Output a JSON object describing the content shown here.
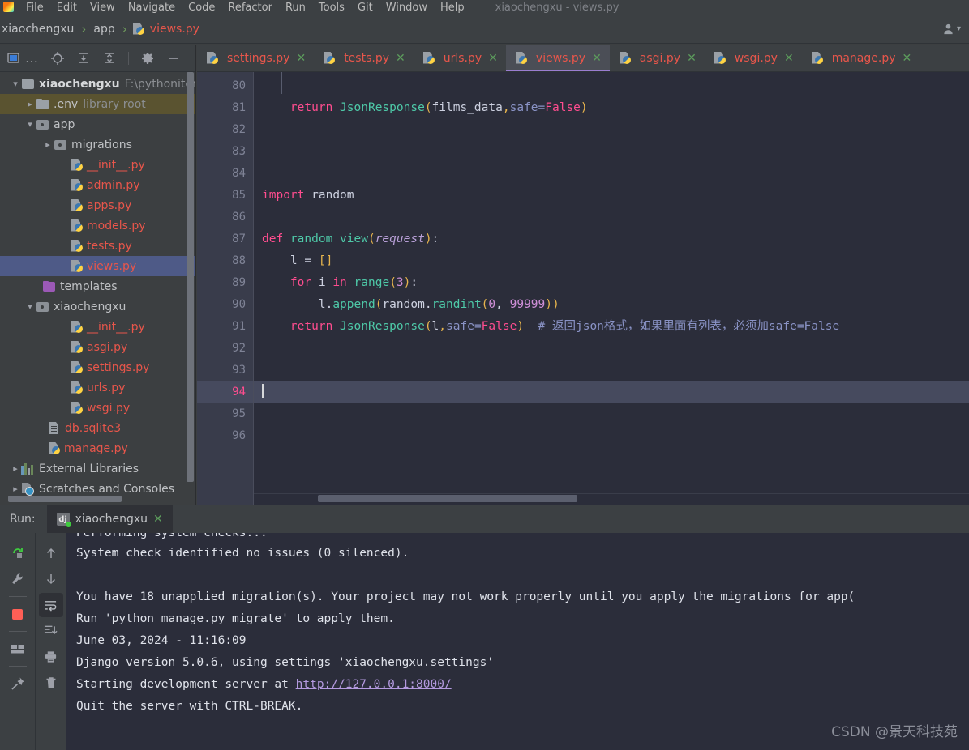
{
  "window": {
    "title": "xiaochengxu - views.py"
  },
  "menubar": {
    "logo": "pycharm-logo",
    "items": [
      {
        "label": "File"
      },
      {
        "label": "Edit"
      },
      {
        "label": "View"
      },
      {
        "label": "Navigate"
      },
      {
        "label": "Code"
      },
      {
        "label": "Refactor"
      },
      {
        "label": "Run"
      },
      {
        "label": "Tools"
      },
      {
        "label": "Git"
      },
      {
        "label": "Window"
      },
      {
        "label": "Help"
      }
    ]
  },
  "breadcrumb": {
    "items": [
      {
        "label": "xiaochengxu",
        "type": "project"
      },
      {
        "label": "app",
        "type": "folder"
      },
      {
        "label": "views.py",
        "type": "file"
      }
    ],
    "separator": "›"
  },
  "navbar": {
    "account_icon": "user-icon",
    "account_caret": "▾"
  },
  "project_panel": {
    "toolbar": [
      {
        "icon": "select-opened-file-icon",
        "glyph": "▣"
      },
      {
        "icon": "more-options-icon",
        "glyph": "…"
      },
      {
        "icon": "locate-icon",
        "glyph": "⊕"
      },
      {
        "icon": "expand-all-icon",
        "glyph": "↧"
      },
      {
        "icon": "collapse-all-icon",
        "glyph": "↥"
      },
      {
        "icon": "settings-gear-icon",
        "glyph": "⚙"
      },
      {
        "icon": "hide-panel-icon",
        "glyph": "—"
      }
    ],
    "tree": [
      {
        "label": "xiaochengxu",
        "secondary": "F:\\pythoniter",
        "type": "root-folder",
        "indent": 0,
        "arrow": "expanded",
        "bold": true,
        "selected": "none"
      },
      {
        "label": ".env",
        "secondary": "library root",
        "type": "folder",
        "indent": 1,
        "arrow": "collapsed",
        "bold": false,
        "selected": "olive"
      },
      {
        "label": "app",
        "secondary": "",
        "type": "module-folder",
        "indent": 1,
        "arrow": "expanded",
        "bold": false,
        "selected": "none"
      },
      {
        "label": "migrations",
        "secondary": "",
        "type": "module-folder",
        "indent": 2,
        "arrow": "collapsed",
        "bold": false,
        "selected": "none"
      },
      {
        "label": "__init__.py",
        "secondary": "",
        "type": "python-file",
        "indent": 3,
        "arrow": "none",
        "bold": false,
        "selected": "none"
      },
      {
        "label": "admin.py",
        "secondary": "",
        "type": "python-file",
        "indent": 3,
        "arrow": "none",
        "bold": false,
        "selected": "none"
      },
      {
        "label": "apps.py",
        "secondary": "",
        "type": "python-file",
        "indent": 3,
        "arrow": "none",
        "bold": false,
        "selected": "none"
      },
      {
        "label": "models.py",
        "secondary": "",
        "type": "python-file",
        "indent": 3,
        "arrow": "none",
        "bold": false,
        "selected": "none"
      },
      {
        "label": "tests.py",
        "secondary": "",
        "type": "python-file",
        "indent": 3,
        "arrow": "none",
        "bold": false,
        "selected": "none"
      },
      {
        "label": "views.py",
        "secondary": "",
        "type": "python-file",
        "indent": 3,
        "arrow": "none",
        "bold": false,
        "selected": "blue"
      },
      {
        "label": "templates",
        "secondary": "",
        "type": "templates-folder",
        "indent": 2,
        "arrow": "none",
        "bold": false,
        "selected": "none"
      },
      {
        "label": "xiaochengxu",
        "secondary": "",
        "type": "module-folder",
        "indent": 1,
        "arrow": "expanded",
        "bold": false,
        "selected": "none"
      },
      {
        "label": "__init__.py",
        "secondary": "",
        "type": "python-file",
        "indent": 3,
        "arrow": "none",
        "bold": false,
        "selected": "none"
      },
      {
        "label": "asgi.py",
        "secondary": "",
        "type": "python-file",
        "indent": 3,
        "arrow": "none",
        "bold": false,
        "selected": "none"
      },
      {
        "label": "settings.py",
        "secondary": "",
        "type": "python-file",
        "indent": 3,
        "arrow": "none",
        "bold": false,
        "selected": "none"
      },
      {
        "label": "urls.py",
        "secondary": "",
        "type": "python-file",
        "indent": 3,
        "arrow": "none",
        "bold": false,
        "selected": "none"
      },
      {
        "label": "wsgi.py",
        "secondary": "",
        "type": "python-file",
        "indent": 3,
        "arrow": "none",
        "bold": false,
        "selected": "none"
      },
      {
        "label": "db.sqlite3",
        "secondary": "",
        "type": "db-file",
        "indent": 2,
        "arrow": "none",
        "bold": false,
        "selected": "none"
      },
      {
        "label": "manage.py",
        "secondary": "",
        "type": "python-file",
        "indent": 2,
        "arrow": "none",
        "bold": false,
        "selected": "none"
      },
      {
        "label": "External Libraries",
        "secondary": "",
        "type": "libraries",
        "indent": 0,
        "arrow": "collapsed",
        "bold": false,
        "selected": "none"
      },
      {
        "label": "Scratches and Consoles",
        "secondary": "",
        "type": "scratches",
        "indent": 0,
        "arrow": "collapsed",
        "bold": false,
        "selected": "none"
      }
    ]
  },
  "editor": {
    "tabs": [
      {
        "label": "settings.py",
        "active": false,
        "close": "✕"
      },
      {
        "label": "tests.py",
        "active": false,
        "close": "✕"
      },
      {
        "label": "urls.py",
        "active": false,
        "close": "✕"
      },
      {
        "label": "views.py",
        "active": true,
        "close": "✕"
      },
      {
        "label": "asgi.py",
        "active": false,
        "close": "✕"
      },
      {
        "label": "wsgi.py",
        "active": false,
        "close": "✕"
      },
      {
        "label": "manage.py",
        "active": false,
        "close": "✕"
      }
    ],
    "first_line": 80,
    "current_line": 94,
    "lines": [
      {
        "n": 80,
        "text": ""
      },
      {
        "n": 81,
        "text": "    return JsonResponse(films_data,safe=False)"
      },
      {
        "n": 82,
        "text": ""
      },
      {
        "n": 83,
        "text": ""
      },
      {
        "n": 84,
        "text": ""
      },
      {
        "n": 85,
        "text": "import random"
      },
      {
        "n": 86,
        "text": ""
      },
      {
        "n": 87,
        "text": "def random_view(request):"
      },
      {
        "n": 88,
        "text": "    l = []"
      },
      {
        "n": 89,
        "text": "    for i in range(3):"
      },
      {
        "n": 90,
        "text": "        l.append(random.randint(0, 99999))"
      },
      {
        "n": 91,
        "text": "    return JsonResponse(l,safe=False)  # 返回json格式，如果里面有列表，必须加safe=False"
      },
      {
        "n": 92,
        "text": ""
      },
      {
        "n": 93,
        "text": ""
      },
      {
        "n": 94,
        "text": ""
      },
      {
        "n": 95,
        "text": ""
      },
      {
        "n": 96,
        "text": ""
      }
    ],
    "code_tokens": {
      "l81": {
        "kw_return": "return",
        "fn": "JsonResponse",
        "open": "(",
        "arg": "films_data",
        "comma": ",",
        "kwarg": "safe",
        "eq": "=",
        "val": "False",
        "close": ")"
      },
      "l85": {
        "kw_import": "import",
        "mod": "random"
      },
      "l87": {
        "kw_def": "def",
        "name": "random_view",
        "open": "(",
        "param": "request",
        "close": ")",
        "colon": ":"
      },
      "l88": {
        "var": "l",
        "eq": "=",
        "brackets": "[]"
      },
      "l89": {
        "kw_for": "for",
        "var": "i",
        "kw_in": "in",
        "fn": "range",
        "open": "(",
        "num": "3",
        "close": ")",
        "colon": ":"
      },
      "l90": {
        "var": "l",
        "dot": ".",
        "fn": "append",
        "open": "(",
        "mod": "random",
        "dot2": ".",
        "fn2": "randint",
        "open2": "(",
        "num1": "0",
        "comma": ", ",
        "num2": "99999",
        "close": "))"
      },
      "l91": {
        "kw_return": "return",
        "fn": "JsonResponse",
        "open": "(",
        "arg": "l",
        "comma": ",",
        "kwarg": "safe",
        "eq": "=",
        "val": "False",
        "close": ")",
        "comment": "# 返回json格式，如果里面有列表，必须加safe=False"
      }
    }
  },
  "run_panel": {
    "label": "Run:",
    "tab": {
      "label": "xiaochengxu",
      "icon": "django-icon",
      "icon_text": "dj",
      "status": "running",
      "close": "✕"
    },
    "toolbar_left": [
      {
        "icon": "rerun-icon",
        "glyph": "↻"
      },
      {
        "icon": "settings-wrench-icon",
        "glyph": "🔧"
      },
      {
        "icon": "stop-icon",
        "glyph": "■"
      },
      {
        "icon": "layout-icon",
        "glyph": "▥"
      },
      {
        "icon": "pin-icon",
        "glyph": "📌"
      }
    ],
    "toolbar_right": [
      {
        "icon": "up-arrow-icon",
        "glyph": "↑"
      },
      {
        "icon": "down-arrow-icon",
        "glyph": "↓"
      },
      {
        "icon": "soft-wrap-icon",
        "glyph": "↵"
      },
      {
        "icon": "scroll-to-end-icon",
        "glyph": "↧"
      },
      {
        "icon": "print-icon",
        "glyph": "⎙"
      },
      {
        "icon": "clear-all-icon",
        "glyph": "🗑"
      }
    ],
    "console": {
      "clipped_top": "Performing system checks...",
      "lines": [
        {
          "text": "System check identified no issues (0 silenced)."
        },
        {
          "text": ""
        },
        {
          "text": "You have 18 unapplied migration(s). Your project may not work properly until you apply the migrations for app("
        },
        {
          "text": "Run 'python manage.py migrate' to apply them."
        },
        {
          "text": "June 03, 2024 - 11:16:09"
        },
        {
          "text": "Django version 5.0.6, using settings 'xiaochengxu.settings'"
        },
        {
          "text": "Starting development server at ",
          "link": "http://127.0.0.1:8000/"
        },
        {
          "text": "Quit the server with CTRL-BREAK."
        }
      ]
    }
  },
  "watermark": {
    "text": "CSDN @景天科技苑"
  },
  "colors": {
    "background": "#3c3f41",
    "editor_background": "#2b2d3a",
    "accent_python_file": "#e8564b",
    "active_tab_underline": "#9a7dd0",
    "selection_blue": "#4e5a87",
    "selection_olive": "#5a5330",
    "current_line_number": "#ff4d8f",
    "keyword": "#ff4d8f",
    "function": "#4ec9a8",
    "comment": "#8a93c6",
    "link": "#b49ae0",
    "stop_red": "#ff5f56",
    "run_green": "#3fcc3f"
  }
}
